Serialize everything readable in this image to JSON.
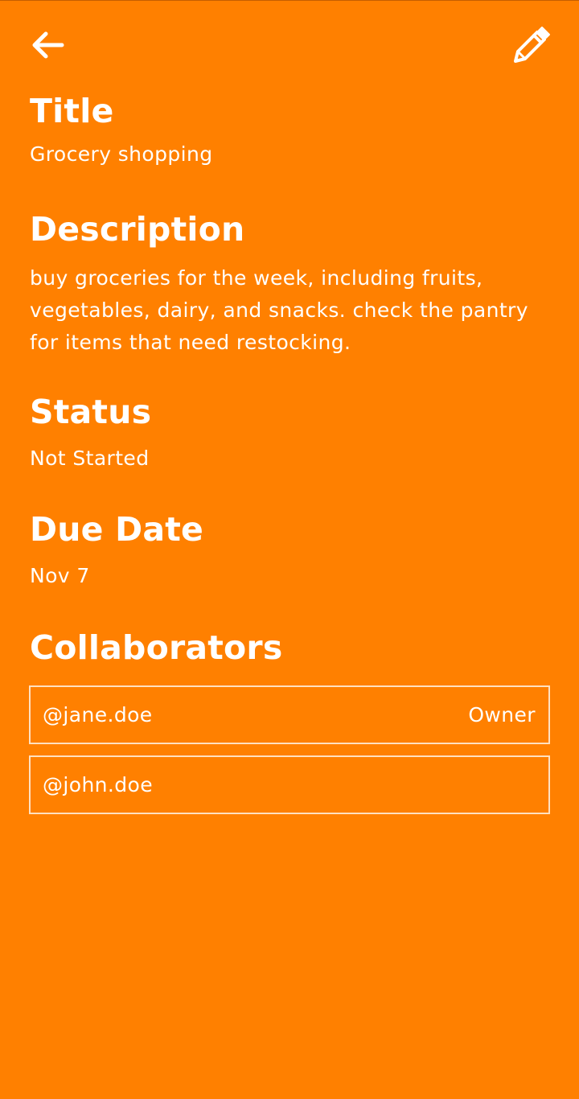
{
  "header": {
    "back_icon": "arrow-left-icon",
    "edit_icon": "pencil-icon"
  },
  "task": {
    "title_heading": "Title",
    "title_value": "Grocery shopping",
    "description_heading": "Description",
    "description_value": "buy groceries for the week, including fruits, vegetables, dairy, and snacks. check the pantry for items that need restocking.",
    "status_heading": "Status",
    "status_value": "Not Started",
    "due_date_heading": "Due Date",
    "due_date_value": "Nov 7",
    "collaborators_heading": "Collaborators",
    "collaborators": [
      {
        "handle": "@jane.doe",
        "role": "Owner"
      },
      {
        "handle": "@john.doe",
        "role": ""
      }
    ]
  },
  "colors": {
    "background": "#ff8000",
    "text": "#ffffff",
    "border": "#ffe0c0"
  }
}
